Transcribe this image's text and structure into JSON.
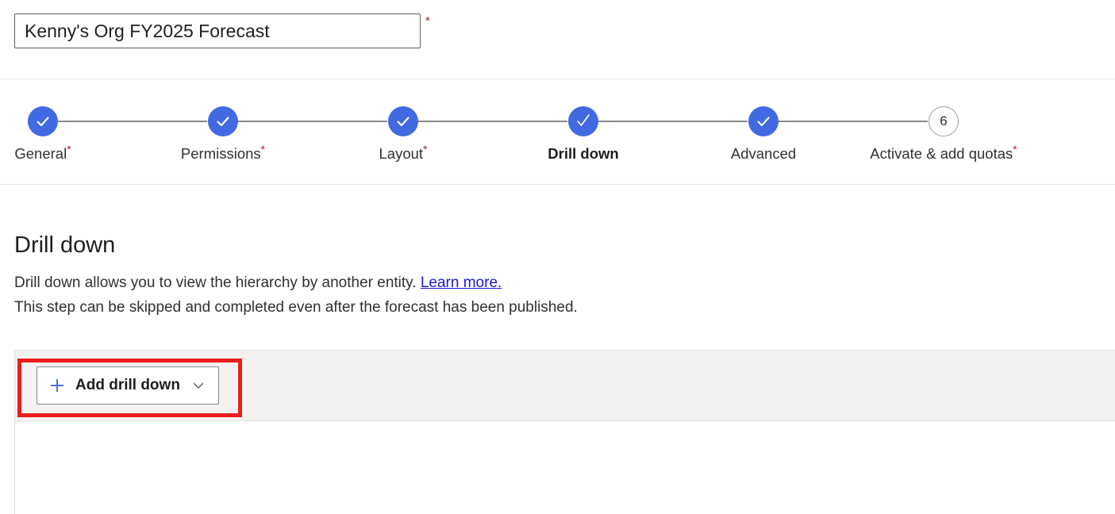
{
  "form": {
    "title_value": "Kenny's Org FY2025 Forecast",
    "title_placeholder": "Forecast name",
    "required_marker": "*"
  },
  "stepper": {
    "steps": [
      {
        "index": 1,
        "label": "General",
        "required": true,
        "state": "completed",
        "marker": "✓"
      },
      {
        "index": 2,
        "label": "Permissions",
        "required": true,
        "state": "completed",
        "marker": "✓"
      },
      {
        "index": 3,
        "label": "Layout",
        "required": true,
        "state": "completed",
        "marker": "✓"
      },
      {
        "index": 4,
        "label": "Drill down",
        "required": false,
        "state": "current",
        "marker": "✓"
      },
      {
        "index": 5,
        "label": "Advanced",
        "required": false,
        "state": "completed",
        "marker": "✓"
      },
      {
        "index": 6,
        "label": "Activate & add quotas",
        "required": true,
        "state": "pending",
        "marker": "6"
      }
    ],
    "labels": {
      "step1": "General",
      "step2": "Permissions",
      "step3": "Layout",
      "step4": "Drill down",
      "step5": "Advanced",
      "step6": "Activate & add quotas",
      "step6_number": "6"
    }
  },
  "main": {
    "heading": "Drill down",
    "description_part1": "Drill down allows you to view the hierarchy by another entity.",
    "learn_more_link": "Learn more.",
    "description_line2": "This step can be skipped and completed even after the forecast has been published."
  },
  "command_bar": {
    "add_drill_down_label": "Add drill down",
    "plus_icon": "plus-icon",
    "chevron_icon": "chevron-down-icon"
  },
  "colors": {
    "accent_blue": "#4169e1",
    "link_blue": "#1b1bd6",
    "required_red": "#a4262c",
    "annotation_red": "#ee1c1c",
    "command_bar_bg": "#f3f2f1",
    "plus_blue": "#4a72e0"
  }
}
